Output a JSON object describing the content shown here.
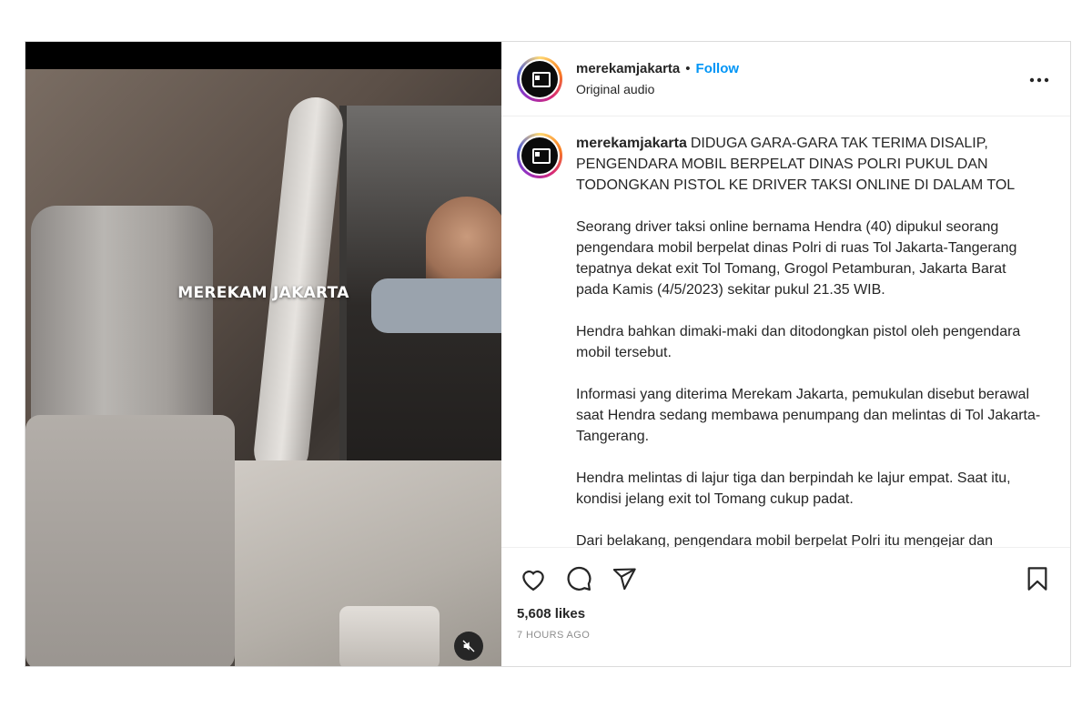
{
  "media": {
    "watermark": "MEREKAM JAKARTA",
    "mute_icon": "speaker-muted-icon"
  },
  "header": {
    "username": "merekamjakarta",
    "separator": "•",
    "follow_label": "Follow",
    "audio": "Original audio",
    "more_icon": "more-horizontal-icon"
  },
  "caption": {
    "username": "merekamjakarta",
    "headline": "DIDUGA GARA-GARA TAK TERIMA DISALIP, PENGENDARA MOBIL BERPELAT DINAS POLRI PUKUL DAN TODONGKAN PISTOL KE DRIVER TAKSI ONLINE DI DALAM TOL",
    "paragraphs": [
      "Seorang driver taksi online bernama Hendra (40) dipukul seorang pengendara mobil berpelat dinas Polri di ruas Tol Jakarta-Tangerang tepatnya dekat exit Tol Tomang, Grogol Petamburan, Jakarta Barat pada Kamis (4/5/2023) sekitar pukul 21.35 WIB.",
      "Hendra bahkan dimaki-maki dan ditodongkan pistol oleh pengendara mobil tersebut.",
      "Informasi yang diterima Merekam Jakarta, pemukulan disebut berawal saat Hendra sedang membawa penumpang dan melintas di Tol Jakarta-Tangerang.",
      "Hendra melintas di lajur tiga dan berpindah ke lajur empat. Saat itu, kondisi jelang exit tol Tomang cukup padat.",
      "Dari belakang, pengendara mobil berpelat Polri itu mengejar dan"
    ]
  },
  "actions": {
    "icons": [
      "heart-icon",
      "comment-icon",
      "share-icon",
      "bookmark-icon"
    ],
    "likes": "5,608 likes",
    "time": "7 HOURS AGO"
  }
}
